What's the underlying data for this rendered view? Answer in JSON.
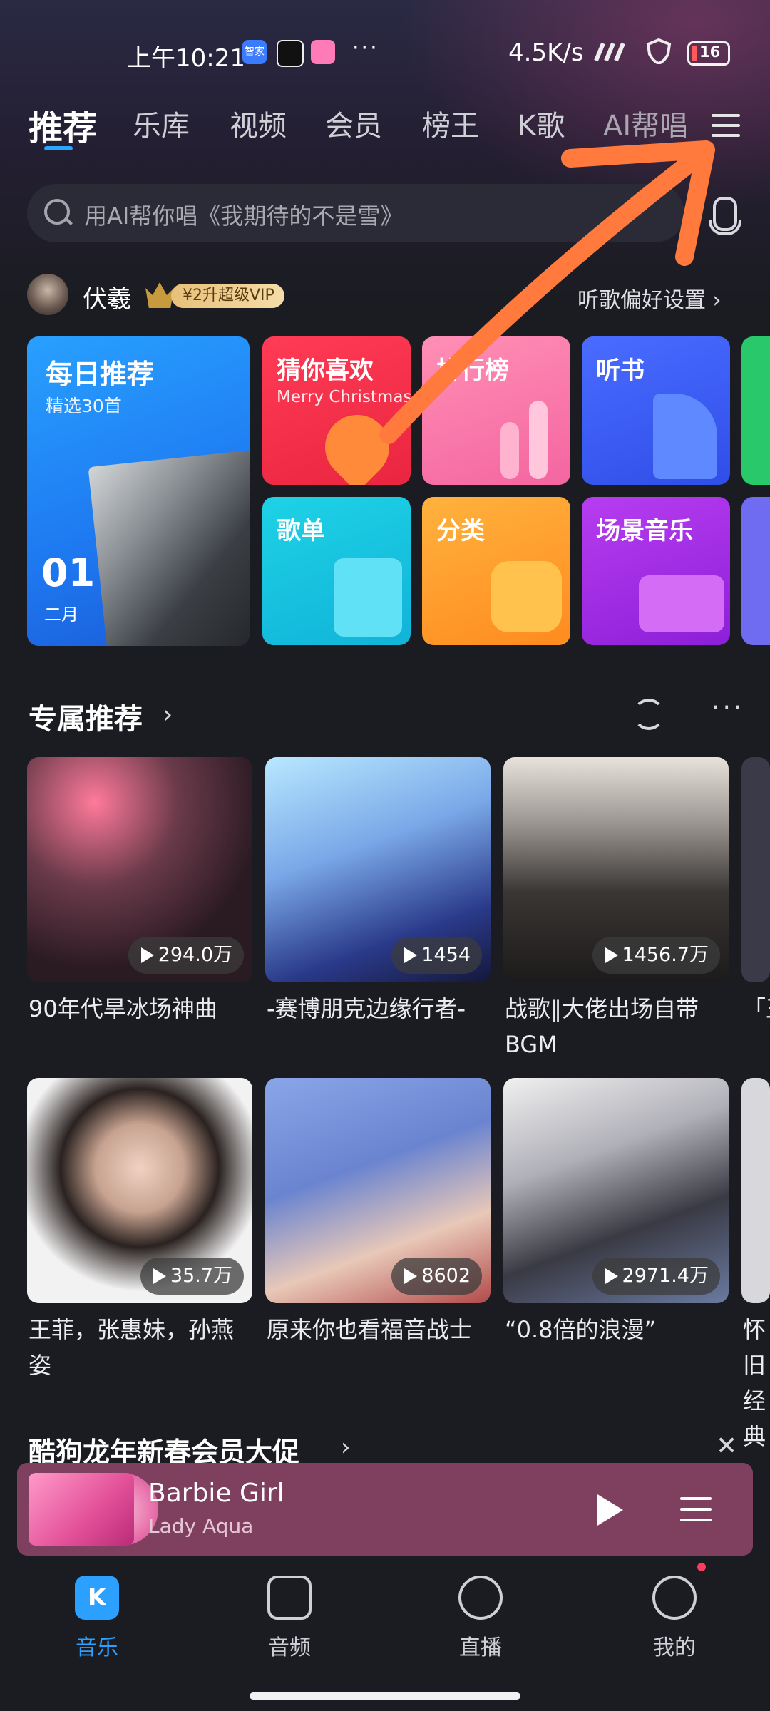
{
  "status_bar": {
    "time": "上午10:21",
    "app_icon_1": "智家",
    "more": "···",
    "net_speed": "4.5K/s",
    "battery": "16"
  },
  "tabs": [
    "推荐",
    "乐库",
    "视频",
    "会员",
    "榜王",
    "K歌",
    "AI帮唱"
  ],
  "search": {
    "placeholder": "用AI帮你唱《我期待的不是雪》"
  },
  "user": {
    "name": "伏羲",
    "vip_badge": "¥2升超级VIP",
    "prefs_link": "听歌偏好设置 ›"
  },
  "tiles": {
    "daily": {
      "title": "每日推荐",
      "subtitle": "精选30首",
      "day": "01",
      "month": "二月"
    },
    "guess": {
      "title": "猜你喜欢",
      "subtitle": "Merry Christmas"
    },
    "rank": {
      "title": "排行榜"
    },
    "book": {
      "title": "听书"
    },
    "playlist": {
      "title": "歌单"
    },
    "category": {
      "title": "分类"
    },
    "scene": {
      "title": "场景音乐"
    }
  },
  "section": {
    "title": "专属推荐",
    "chevron": "›",
    "more": "···"
  },
  "cards": [
    {
      "title": "90年代旱冰场神曲",
      "plays": "294.0万"
    },
    {
      "title": "-赛博朋克边缘行者-",
      "plays": "1454"
    },
    {
      "title": "战歌‖大佬出场自带BGM",
      "plays": "1456.7万"
    },
    {
      "title": "「王",
      "plays": ""
    },
    {
      "title": "王菲，张惠妹，孙燕姿",
      "plays": "35.7万"
    },
    {
      "title": "原来你也看福音战士",
      "plays": "8602"
    },
    {
      "title": "“0.8倍的浪漫”",
      "plays": "2971.4万"
    },
    {
      "title": "怀旧经典",
      "plays": ""
    }
  ],
  "promo": {
    "title": "酷狗龙年新春会员大促",
    "chevron": "›",
    "close": "✕"
  },
  "player": {
    "title": "Barbie Girl",
    "artist": "Lady Aqua"
  },
  "nav": [
    "音乐",
    "音频",
    "直播",
    "我的"
  ],
  "colors": {
    "accent": "#2ba0ff",
    "player_bg": "#7f3f5e",
    "arrow": "#ff7a3c"
  }
}
